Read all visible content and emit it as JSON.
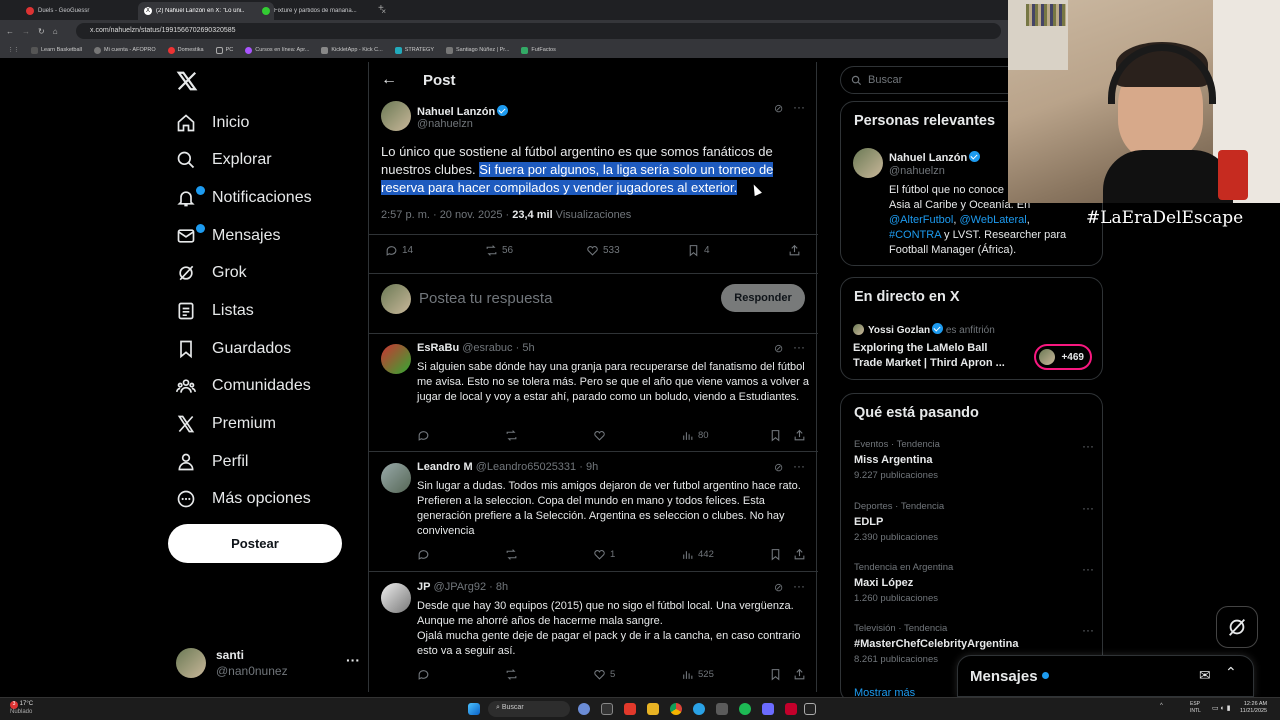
{
  "browser": {
    "tabs": [
      {
        "title": "Duels - GeoGuessr",
        "active": false,
        "color": "#d33"
      },
      {
        "title": "(2) Nahuel Lanzón en X: \"Lo úni...",
        "active": true,
        "color": "#fff"
      },
      {
        "title": "Fixture y partidos de mañana...",
        "active": false,
        "color": "#3c3"
      }
    ],
    "url": "x.com/nahuelzn/status/1991566702690320585",
    "bookmarks": [
      "Learn Basketball",
      "Mi cuenta - AFOPRO",
      "Domestika",
      "PC",
      "Cursos en línea: Apr...",
      "KickletApp - Kick C...",
      "STRATEGY",
      "Santiago Núñez | Pr...",
      "FutFactos"
    ]
  },
  "sidebar": {
    "logo": "X",
    "items": [
      {
        "label": "Inicio",
        "icon": "home-icon"
      },
      {
        "label": "Explorar",
        "icon": "search-icon"
      },
      {
        "label": "Notificaciones",
        "icon": "bell-icon",
        "badge": true
      },
      {
        "label": "Mensajes",
        "icon": "mail-icon",
        "badge": true
      },
      {
        "label": "Grok",
        "icon": "grok-icon"
      },
      {
        "label": "Listas",
        "icon": "list-icon"
      },
      {
        "label": "Guardados",
        "icon": "bookmark-icon"
      },
      {
        "label": "Comunidades",
        "icon": "communities-icon"
      },
      {
        "label": "Premium",
        "icon": "x-premium-icon"
      },
      {
        "label": "Perfil",
        "icon": "person-icon"
      },
      {
        "label": "Más opciones",
        "icon": "more-icon"
      }
    ],
    "post_button": "Postear",
    "user": {
      "name": "santi",
      "handle": "@nan0nunez"
    }
  },
  "main": {
    "header": "Post",
    "post": {
      "author": "Nahuel Lanzón",
      "handle": "@nahuelzn",
      "text_plain": "Lo único que sostiene al fútbol argentino es que somos fanáticos de nuestros clubes. ",
      "text_selected": "Si fuera por algunos, la liga sería solo un torneo de reserva para hacer compilados y vender jugadores al exterior.",
      "time": "2:57 p. m. · 20 nov. 2025 · ",
      "views_count": "23,4 mil",
      "views_label": " Visualizaciones",
      "replies": "14",
      "reposts": "56",
      "likes": "533",
      "bookmarks": "4"
    },
    "compose": {
      "placeholder": "Postea tu respuesta",
      "button": "Responder"
    },
    "replies": [
      {
        "name": "EsRaBu",
        "handle": "@esrabuc",
        "time": "5h",
        "text": "Si alguien sabe dónde hay una granja para recuperarse del fanatismo del fútbol me avisa. Esto no se tolera más. Pero se que el año que viene vamos a volver a jugar de local y voy a estar ahí, parado como un boludo, viendo a Estudiantes.",
        "likes": "",
        "views": "80"
      },
      {
        "name": "Leandro M",
        "handle": "@Leandro65025331",
        "time": "9h",
        "text": "Sin lugar a dudas. Todos mis amigos dejaron de ver futbol argentino hace rato. Prefieren a la seleccion. Copa del mundo en mano y todos felices. Esta generación prefiere a la Selección. Argentina es seleccion o clubes. No hay convivencia",
        "likes": "1",
        "views": "442"
      },
      {
        "name": "JP",
        "handle": "@JPArg92",
        "time": "8h",
        "text": "Desde que hay 30 equipos (2015) que no sigo el fútbol local. Una vergüenza. Aunque me ahorré años de hacerme mala sangre.\nOjalá mucha gente deje de pagar el pack y de ir a la cancha, en caso contrario esto va a seguir así.",
        "likes": "5",
        "views": "525"
      }
    ]
  },
  "right": {
    "search_placeholder": "Buscar",
    "relevant": {
      "title": "Personas relevantes",
      "name": "Nahuel Lanzón",
      "handle": "@nahuelzn",
      "bio1": "El fútbol que no conoce",
      "bio2": "Asia al Caribe y Oceanía. En",
      "link1": "@AlterFutbol",
      "sep1": ", ",
      "link2": "@WebLateral",
      "sep2": ",",
      "link3": "#CONTRA",
      "bio3": " y LVST. Researcher para",
      "bio4": "Football Manager (África)."
    },
    "live": {
      "title": "En directo en X",
      "host": "Yossi Gozlan",
      "host_role": "es anfitrión",
      "space_title": "Exploring the LaMelo Ball Trade Market | Third Apron ...",
      "listeners": "+469"
    },
    "trends_title": "Qué está pasando",
    "trends": [
      {
        "context": "Eventos · Tendencia",
        "title": "Miss Argentina",
        "count": "9.227 publicaciones"
      },
      {
        "context": "Deportes · Tendencia",
        "title": "EDLP",
        "count": "2.390 publicaciones"
      },
      {
        "context": "Tendencia en Argentina",
        "title": "Maxi López",
        "count": "1.260 publicaciones"
      },
      {
        "context": "Televisión · Tendencia",
        "title": "#MasterChefCelebrityArgentina",
        "count": "8.261 publicaciones"
      }
    ],
    "show_more": "Mostrar más"
  },
  "messages_drawer": "Mensajes",
  "overlay_tag": "#LaEraDelEscape",
  "taskbar": {
    "weather": "17°C",
    "weather_desc": "Nublado",
    "search": "Buscar",
    "lang1": "ESP",
    "lang2": "INTL",
    "time": "12:26 AM",
    "date": "11/21/2025"
  },
  "colors": {
    "accent": "#1d9bf0",
    "bg": "#000000",
    "border": "#2f3336",
    "muted": "#71767b",
    "live": "#f91880"
  }
}
